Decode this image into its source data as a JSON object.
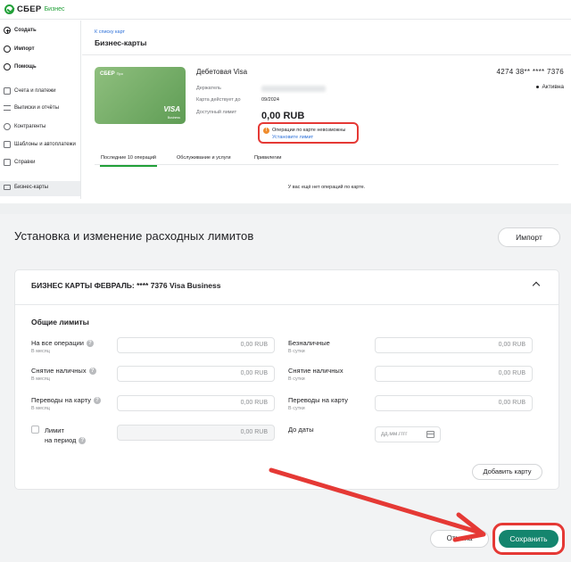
{
  "app": {
    "brand": "СБЕР",
    "sub": "Бизнес"
  },
  "sidebar": {
    "items": [
      {
        "label": "Создать",
        "icon": "plus-circle-icon"
      },
      {
        "label": "Импорт",
        "icon": "import-icon"
      },
      {
        "label": "Помощь",
        "icon": "help-icon"
      },
      {
        "label": "Счета и платежи",
        "icon": "accounts-icon"
      },
      {
        "label": "Выписки и отчёты",
        "icon": "statements-icon"
      },
      {
        "label": "Контрагенты",
        "icon": "contractors-icon"
      },
      {
        "label": "Шаблоны и автоплатежи",
        "icon": "templates-icon"
      },
      {
        "label": "Справки",
        "icon": "certificates-icon"
      },
      {
        "label": "Бизнес-карты",
        "icon": "card-icon"
      }
    ]
  },
  "card_page": {
    "breadcrumb": "К списку карт",
    "title": "Бизнес-карты",
    "card_image": {
      "brand": "СБЕР",
      "tier": "Про",
      "network": "VISA",
      "network_sub": "Business"
    },
    "card_name": "Дебетовая Visa",
    "fields": [
      {
        "label": "Держатель",
        "value": ""
      },
      {
        "label": "Карта действует до",
        "value": "09/2024"
      },
      {
        "label": "Доступный лимит",
        "value": ""
      }
    ],
    "available_limit": "0,00 RUB",
    "warning": {
      "text": "Операции по карте невозможны",
      "link": "Установите лимит"
    },
    "card_number": "4274 38** **** 7376",
    "status": "Активна",
    "tabs": [
      "Последние 10 операций",
      "Обслуживание и услуги",
      "Привилегии"
    ],
    "empty_state": "У вас ещё нет операций по карте."
  },
  "limits_page": {
    "title": "Установка и изменение расходных лимитов",
    "import_button": "Импорт",
    "section_title": "БИЗНЕС КАРТЫ ФЕВРАЛЬ: **** 7376 Visa Business",
    "group_title": "Общие лимиты",
    "rows_left": [
      {
        "label": "На все операции",
        "sub": "В месяц",
        "value": "0,00",
        "currency": "RUB"
      },
      {
        "label": "Снятие наличных",
        "sub": "В месяц",
        "value": "0,00",
        "currency": "RUB"
      },
      {
        "label": "Переводы на карту",
        "sub": "В месяц",
        "value": "0,00",
        "currency": "RUB"
      }
    ],
    "rows_right": [
      {
        "label": "Безналичные",
        "sub": "В сутки",
        "value": "0,00",
        "currency": "RUB"
      },
      {
        "label": "Снятие наличных",
        "sub": "В сутки",
        "value": "0,00",
        "currency": "RUB"
      },
      {
        "label": "Переводы на карту",
        "sub": "В сутки",
        "value": "0,00",
        "currency": "RUB"
      }
    ],
    "period_limit": {
      "label_line1": "Лимит",
      "label_line2": "на период",
      "value": "0,00",
      "currency": "RUB"
    },
    "date_label": "До даты",
    "date_placeholder": "дд.мм.гггг",
    "add_card_button": "Добавить карту",
    "cancel_button": "Отмена",
    "save_button": "Сохранить"
  },
  "colors": {
    "brand_green": "#21a038",
    "save_button": "#14856e",
    "highlight_red": "#e53935",
    "link_blue": "#2b6fd8",
    "warning_orange": "#ef8b2c"
  }
}
